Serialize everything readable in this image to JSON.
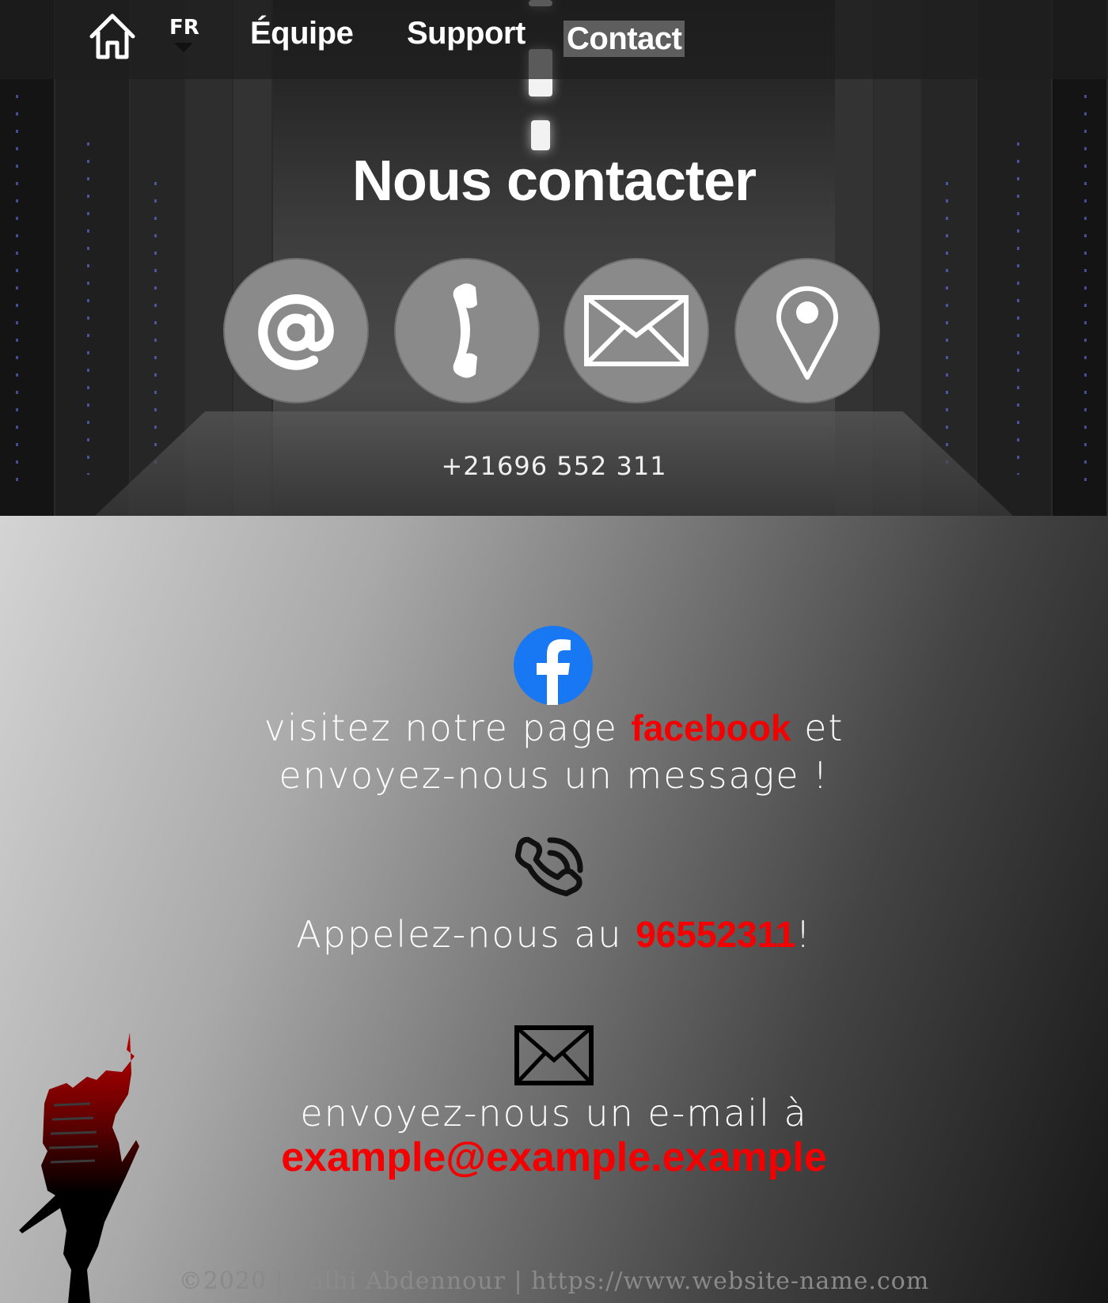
{
  "nav": {
    "language": "FR",
    "items": [
      "Équipe",
      "Support",
      "Contact"
    ],
    "active": "Contact"
  },
  "hero": {
    "title": "Nous contacter",
    "icons": [
      "at-sign-icon",
      "phone-handset-icon",
      "envelope-icon",
      "location-pin-icon"
    ],
    "phone": "+21696 552 311"
  },
  "facebook": {
    "line1_before": "visitez notre page ",
    "link": "facebook",
    "line1_after": " et",
    "line2": "envoyez-nous un message !"
  },
  "call": {
    "prefix": "Appelez-nous au ",
    "number": "96552311",
    "suffix": "!"
  },
  "email": {
    "prefix": "envoyez-nous un e-mail à",
    "address": "example@example.example"
  },
  "footer": "©2020 | Salhi Abdennour | https://www.website-name.com",
  "colors": {
    "accent": "#f40000",
    "facebook": "#1877f2",
    "icon_circle": "#8a8a8a"
  }
}
